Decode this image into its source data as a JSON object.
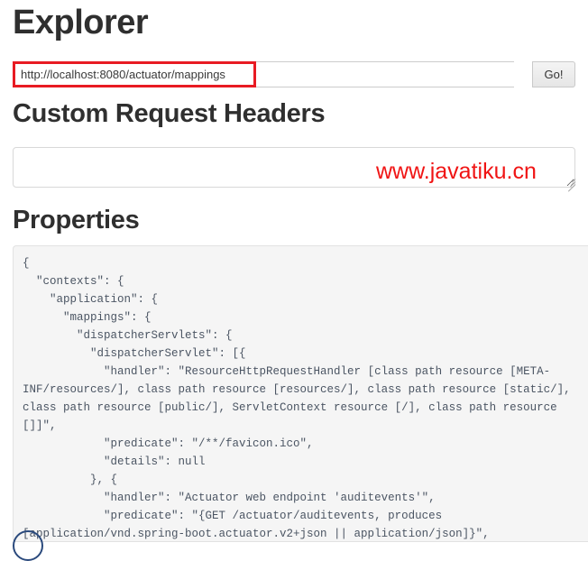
{
  "page": {
    "title": "Explorer"
  },
  "url_bar": {
    "value": "http://localhost:8080/actuator/mappings",
    "placeholder": "",
    "go_label": "Go!",
    "annotation_color": "#e81b23"
  },
  "headers_section": {
    "heading": "Custom Request Headers",
    "textarea_value": "",
    "textarea_placeholder": "",
    "resize_handle": "resize-grip-icon"
  },
  "watermark": {
    "text": "www.javatiku.cn",
    "color": "#f01414"
  },
  "properties_section": {
    "heading": "Properties",
    "json_text": "{\n  \"contexts\": {\n    \"application\": {\n      \"mappings\": {\n        \"dispatcherServlets\": {\n          \"dispatcherServlet\": [{\n            \"handler\": \"ResourceHttpRequestHandler [class path resource [META-INF/resources/], class path resource [resources/], class path resource [static/], class path resource [public/], ServletContext resource [/], class path resource []]\",\n            \"predicate\": \"/**/favicon.ico\",\n            \"details\": null\n          }, {\n            \"handler\": \"Actuator web endpoint 'auditevents'\",\n            \"predicate\": \"{GET /actuator/auditevents, produces [application/vnd.spring-boot.actuator.v2+json || application/json]}\",\n            \"details\": {"
  }
}
